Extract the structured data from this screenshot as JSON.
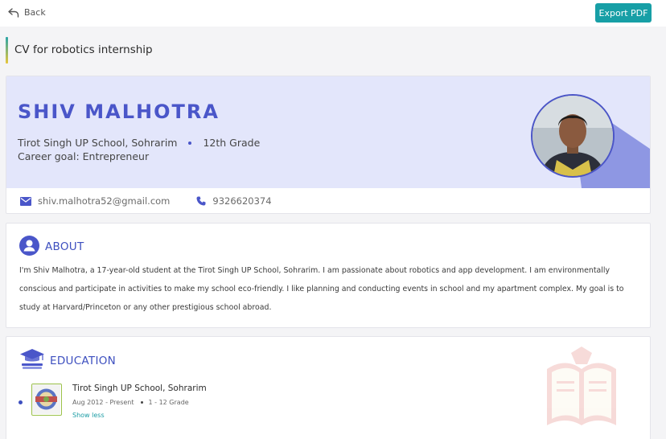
{
  "header": {
    "back_label": "Back",
    "export_label": "Export PDF"
  },
  "page": {
    "title": "CV for robotics internship"
  },
  "profile": {
    "name": "SHIV MALHOTRA",
    "school": "Tirot Singh UP School, Sohrarim",
    "grade": "12th Grade",
    "career_goal": "Career goal: Entrepreneur",
    "email": "shiv.malhotra52@gmail.com",
    "phone": "9326620374"
  },
  "about": {
    "heading": "ABOUT",
    "text": "I'm Shiv Malhotra, a 17-year-old student at the Tirot Singh UP School, Sohrarim. I am passionate about robotics and app development. I am environmentally conscious and participate in activities to make my school eco-friendly. I like planning and conducting events in school and my apartment complex. My goal is to study at Harvard/Princeton or any other prestigious school abroad."
  },
  "education": {
    "heading": "EDUCATION",
    "entries": [
      {
        "school": "Tirot Singh UP School, Sohrarim",
        "period": "Aug 2012 - Present",
        "grades": "1 - 12 Grade",
        "toggle_label": "Show less"
      }
    ]
  },
  "colors": {
    "accent_blue": "#4a56c9",
    "teal": "#179fa6",
    "hero_bg": "#e3e6fb",
    "hero_shape": "#8e97e3"
  },
  "icons": [
    "back-arrow-icon",
    "mail-icon",
    "phone-icon",
    "user-icon",
    "graduation-cap-icon",
    "school-logo",
    "open-book-icon"
  ]
}
